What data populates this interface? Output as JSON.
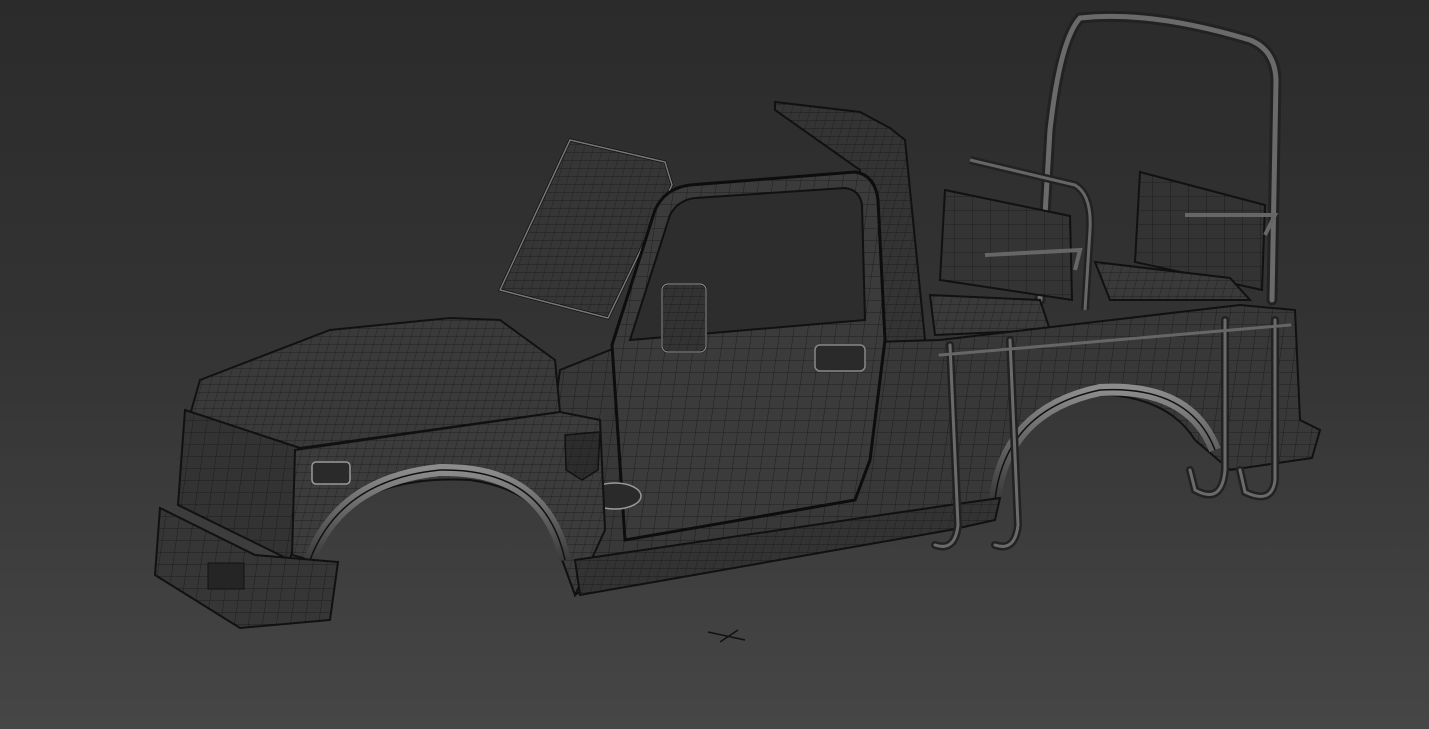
{
  "viewport": {
    "render_mode": "shaded-wireframe",
    "model": "open-top-jeep-body",
    "colors": {
      "background_top": "#2b2b2b",
      "background_bottom": "#464646",
      "body_fill": "#3a3a3a",
      "body_shade": "#2f2f2f",
      "highlight": "#9a9a9a",
      "wire": "#111111"
    }
  },
  "icons": {
    "pivot": "pivot-cross-icon"
  }
}
